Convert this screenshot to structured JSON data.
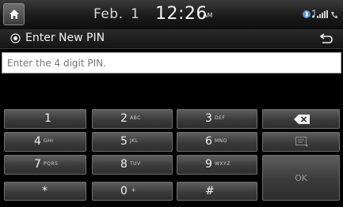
{
  "status_bar": {
    "date": "Feb.",
    "day": "1",
    "time": "12:26",
    "ampm": "AM",
    "icons": [
      "bluetooth-icon",
      "music-icon",
      "signal-icon"
    ]
  },
  "title_bar": {
    "title": "Enter New PIN"
  },
  "pin_input": {
    "placeholder": "Enter the 4 digit PIN."
  },
  "keypad": {
    "keys": [
      {
        "main": "1",
        "sub": ""
      },
      {
        "main": "2",
        "sub": "ABC"
      },
      {
        "main": "3",
        "sub": "DEF"
      },
      {
        "main": "4",
        "sub": "GHI"
      },
      {
        "main": "5",
        "sub": "JKL"
      },
      {
        "main": "6",
        "sub": "MNO"
      },
      {
        "main": "7",
        "sub": "PQRS"
      },
      {
        "main": "8",
        "sub": "TUV"
      },
      {
        "main": "9",
        "sub": "WXYZ"
      },
      {
        "main": "*",
        "sub": ""
      },
      {
        "main": "0",
        "sub": "+"
      },
      {
        "main": "#",
        "sub": ""
      }
    ],
    "ok_label": "OK",
    "backspace_icon": "backspace-icon",
    "keyboard_icon": "keyboard-hide-icon"
  }
}
